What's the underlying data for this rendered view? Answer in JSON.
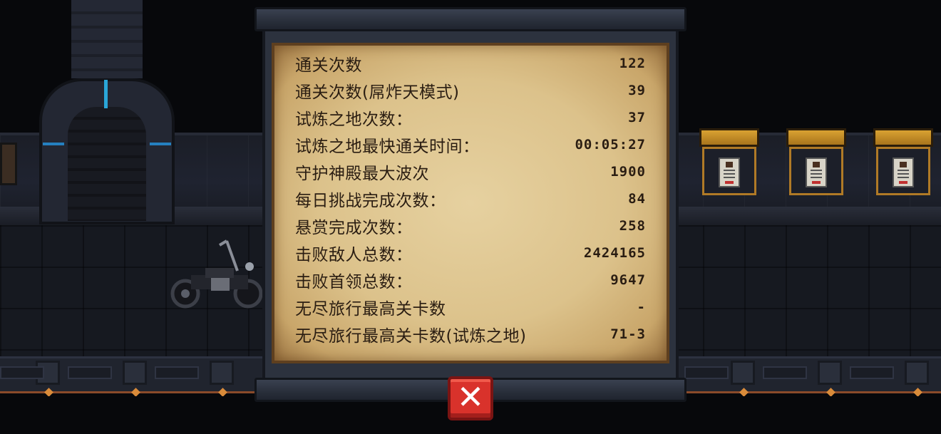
{
  "stats_panel": {
    "rows": [
      {
        "label": "通关次数",
        "value": "122"
      },
      {
        "label": "通关次数(屌炸天模式)",
        "value": "39"
      },
      {
        "label": "试炼之地次数：",
        "value": "37"
      },
      {
        "label": "试炼之地最快通关时间：",
        "value": "00:05:27"
      },
      {
        "label": "守护神殿最大波次",
        "value": "1900"
      },
      {
        "label": "每日挑战完成次数：",
        "value": "84"
      },
      {
        "label": "悬赏完成次数：",
        "value": "258"
      },
      {
        "label": "击败敌人总数：",
        "value": "2424165"
      },
      {
        "label": "击败首领总数：",
        "value": "9647"
      },
      {
        "label": "无尽旅行最高关卡数",
        "value": "-"
      },
      {
        "label": "无尽旅行最高关卡数(试炼之地)",
        "value": "71-3"
      }
    ]
  },
  "close_button": {
    "icon": "close-icon",
    "glyph": "✕"
  },
  "colors": {
    "parchment": "#dcc28b",
    "ink": "#2a1d12",
    "close_red": "#d9322b",
    "panel_frame": "#2c323e"
  },
  "background": {
    "icons": [
      "door-arch",
      "motorbike",
      "picture-frame"
    ]
  }
}
